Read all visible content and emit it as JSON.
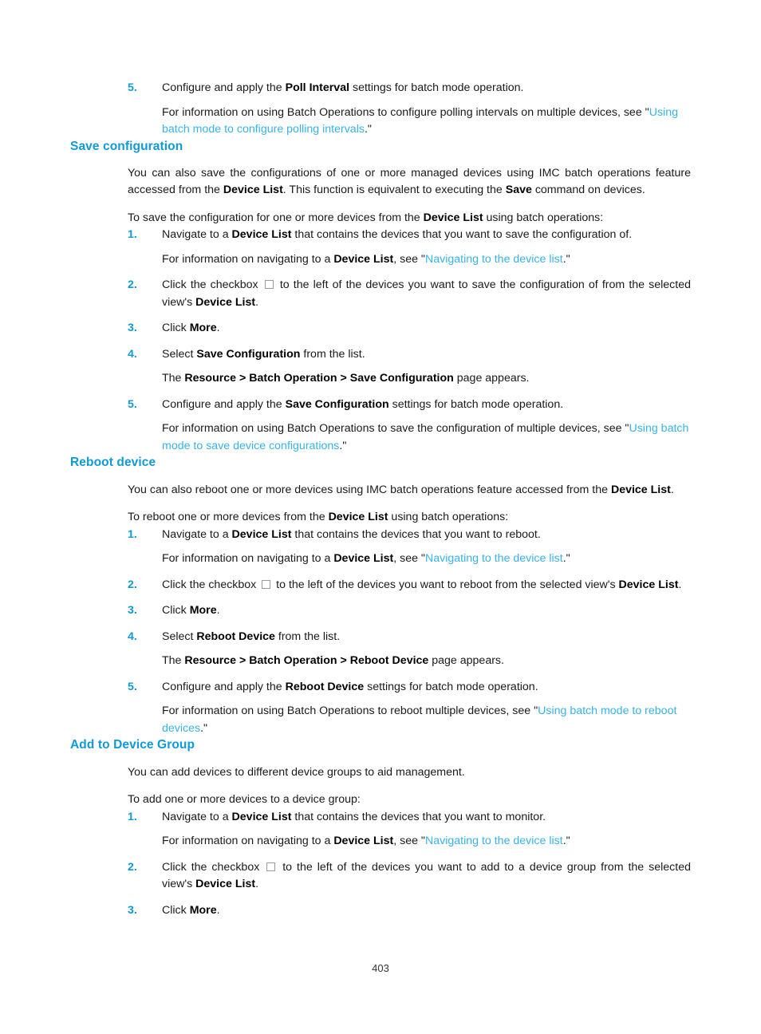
{
  "document": {
    "page_number": "403",
    "colors": {
      "heading": "#0e9ad6",
      "list_number": "#0e9ad6",
      "link": "#37b3e8",
      "body_text": "#1a1a1a",
      "page_background": "#ffffff"
    }
  },
  "top_step": {
    "number": "5.",
    "main_before": "Configure and apply the ",
    "main_bold": "Poll Interval",
    "main_after": " settings for batch mode operation.",
    "sub_before": "For information on using Batch Operations to configure polling intervals on multiple devices, see \"",
    "sub_link": "Using batch mode to configure polling intervals",
    "sub_after": ".\""
  },
  "sections": [
    {
      "heading": "Save configuration",
      "intro_paragraphs": [
        {
          "t1": "You can also save the configurations of one or more managed devices using IMC batch operations feature accessed from the ",
          "b1": "Device List",
          "t2": ". This function is equivalent to executing the ",
          "b2": "Save",
          "t3": " command on devices."
        },
        {
          "t1": "To save the configuration for one or more devices from the ",
          "b1": "Device List",
          "t2": " using batch operations:",
          "b2": "",
          "t3": ""
        }
      ],
      "steps": [
        {
          "number": "1.",
          "main_before": "Navigate to a ",
          "main_bold": "Device List",
          "main_after": " that contains the devices that you want to save the configuration of.",
          "sub_before": "For information on navigating to a ",
          "sub_bold": "Device List",
          "sub_mid": ", see \"",
          "sub_link": "Navigating to the device list",
          "sub_after": ".\""
        },
        {
          "number": "2.",
          "main_before": "Click the checkbox ",
          "checkbox": true,
          "main_after": " to the left of the devices you want to save the configuration of from the selected view's ",
          "main_bold_end": "Device List",
          "main_tail": "."
        },
        {
          "number": "3.",
          "main_before": "Click ",
          "main_bold": "More",
          "main_after": "."
        },
        {
          "number": "4.",
          "main_before": "Select ",
          "main_bold": "Save Configuration",
          "main_after": " from the list.",
          "sub_before": "The ",
          "sub_bold": "Resource > Batch Operation > Save Configuration",
          "sub_after": " page appears."
        },
        {
          "number": "5.",
          "main_before": "Configure and apply the ",
          "main_bold": "Save Configuration",
          "main_after": " settings for batch mode operation.",
          "sub_before": "For information on using Batch Operations to save the configuration of multiple devices, see \"",
          "sub_link": "Using batch mode to save device configurations",
          "sub_after": ".\""
        }
      ]
    },
    {
      "heading": "Reboot device",
      "intro_paragraphs": [
        {
          "t1": "You can also reboot one or more devices using IMC batch operations feature accessed from the ",
          "b1": "Device List",
          "t2": ".",
          "b2": "",
          "t3": ""
        },
        {
          "t1": "To reboot one or more devices from the ",
          "b1": "Device List",
          "t2": " using batch operations:",
          "b2": "",
          "t3": ""
        }
      ],
      "steps": [
        {
          "number": "1.",
          "main_before": "Navigate to a ",
          "main_bold": "Device List",
          "main_after": " that contains the devices that you want to reboot.",
          "sub_before": "For information on navigating to a ",
          "sub_bold": "Device List",
          "sub_mid": ", see \"",
          "sub_link": "Navigating to the device list",
          "sub_after": ".\""
        },
        {
          "number": "2.",
          "main_before": "Click the checkbox ",
          "checkbox": true,
          "main_after": " to the left of the devices you want to reboot from the selected view's ",
          "main_bold_end": "Device List",
          "main_tail": "."
        },
        {
          "number": "3.",
          "main_before": "Click ",
          "main_bold": "More",
          "main_after": "."
        },
        {
          "number": "4.",
          "main_before": "Select ",
          "main_bold": "Reboot Device",
          "main_after": " from the list.",
          "sub_before": "The ",
          "sub_bold": "Resource > Batch Operation > Reboot Device",
          "sub_after": " page appears."
        },
        {
          "number": "5.",
          "main_before": "Configure and apply the ",
          "main_bold": "Reboot Device",
          "main_after": " settings for batch mode operation.",
          "sub_before": "For information on using Batch Operations to reboot multiple devices, see \"",
          "sub_link": "Using batch mode to reboot devices",
          "sub_after": ".\""
        }
      ]
    },
    {
      "heading": "Add to Device Group",
      "intro_paragraphs": [
        {
          "t1": "You can add devices to different device groups to aid management.",
          "b1": "",
          "t2": "",
          "b2": "",
          "t3": ""
        },
        {
          "t1": "To add one or more devices to a device group:",
          "b1": "",
          "t2": "",
          "b2": "",
          "t3": ""
        }
      ],
      "steps": [
        {
          "number": "1.",
          "main_before": "Navigate to a ",
          "main_bold": "Device List",
          "main_after": " that contains the devices that you want to monitor.",
          "sub_before": "For information on navigating to a ",
          "sub_bold": "Device List",
          "sub_mid": ", see \"",
          "sub_link": "Navigating to the device list",
          "sub_after": ".\""
        },
        {
          "number": "2.",
          "main_before": "Click the checkbox ",
          "checkbox": true,
          "main_after": " to the left of the devices you want to add to a device group from the selected view's ",
          "main_bold_end": "Device List",
          "main_tail": "."
        },
        {
          "number": "3.",
          "main_before": "Click ",
          "main_bold": "More",
          "main_after": "."
        }
      ]
    }
  ]
}
